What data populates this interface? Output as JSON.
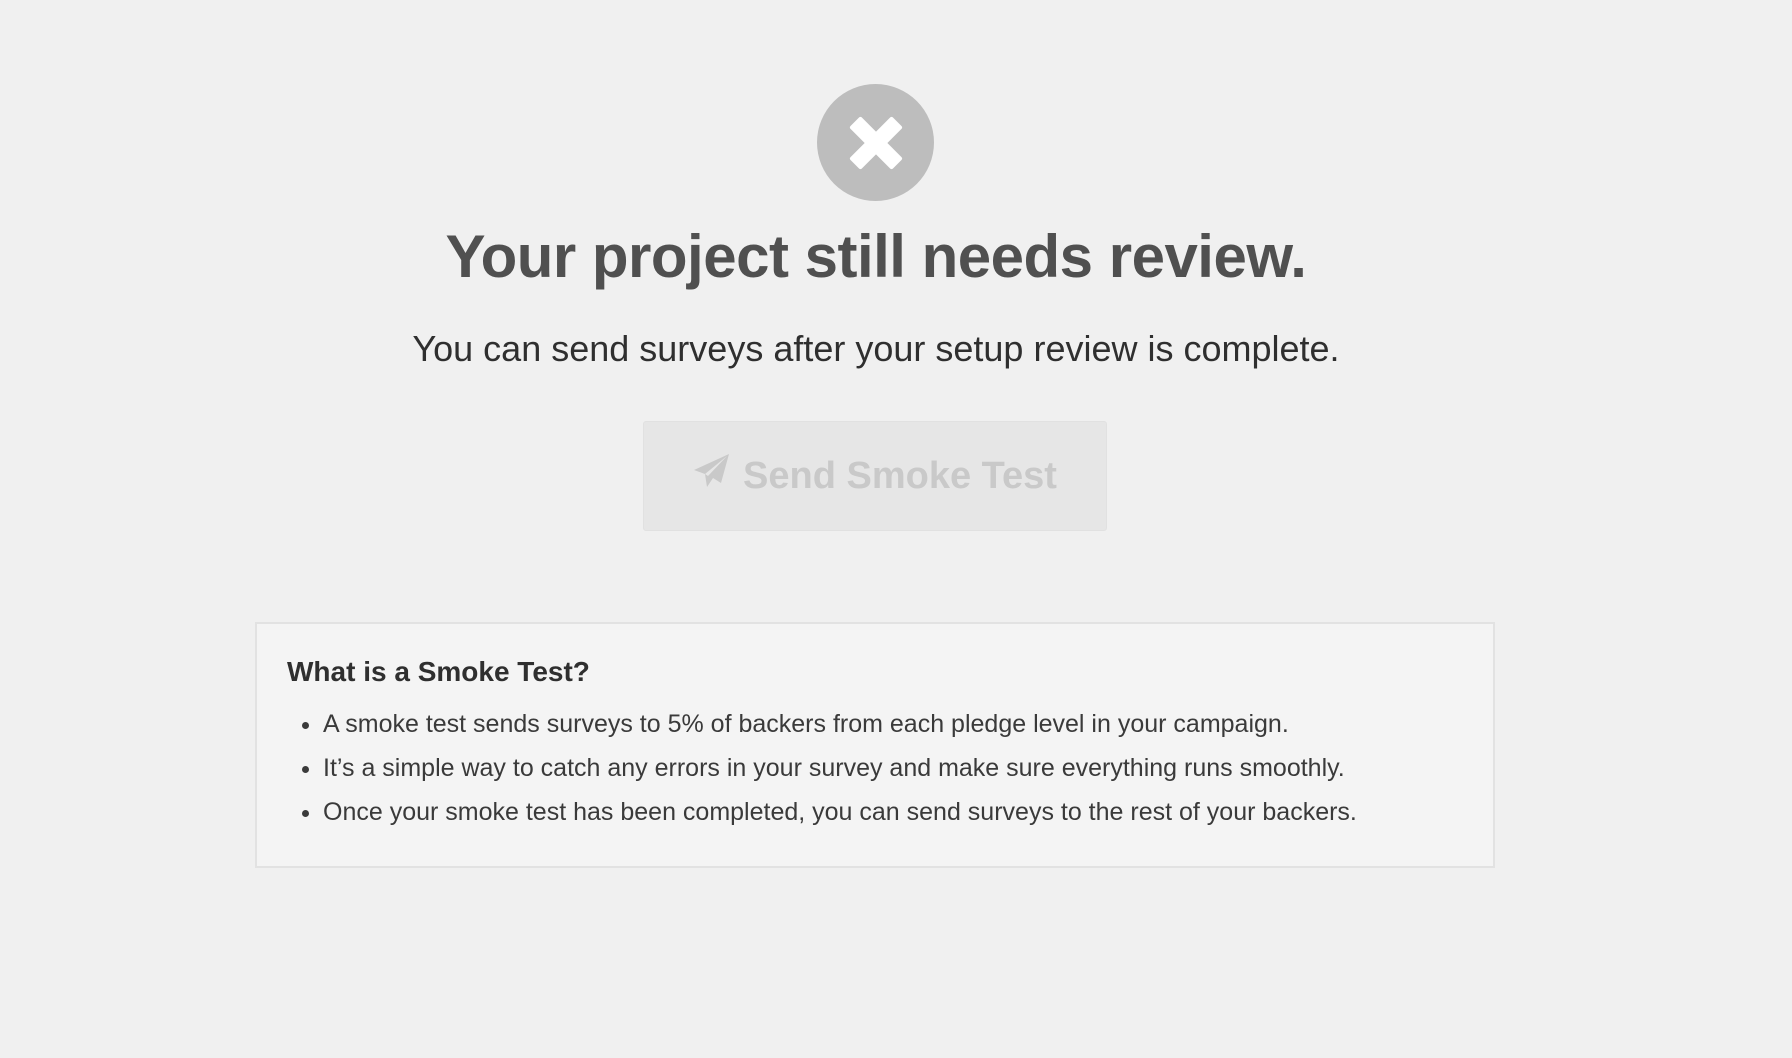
{
  "status": {
    "icon": "x-icon",
    "icon_color": "#bdbdbd",
    "headline": "Your project still needs review.",
    "subline": "You can send surveys after your setup review is complete."
  },
  "send_button": {
    "icon": "paper-plane-icon",
    "label": "Send Smoke Test",
    "state": "disabled"
  },
  "info": {
    "title": "What is a Smoke Test?",
    "bullets": [
      "A smoke test sends surveys to 5% of backers from each pledge level in your campaign.",
      "It’s a simple way to catch any errors in your survey and make sure everything runs smoothly.",
      "Once your smoke test has been completed, you can send surveys to the rest of your backers."
    ]
  }
}
